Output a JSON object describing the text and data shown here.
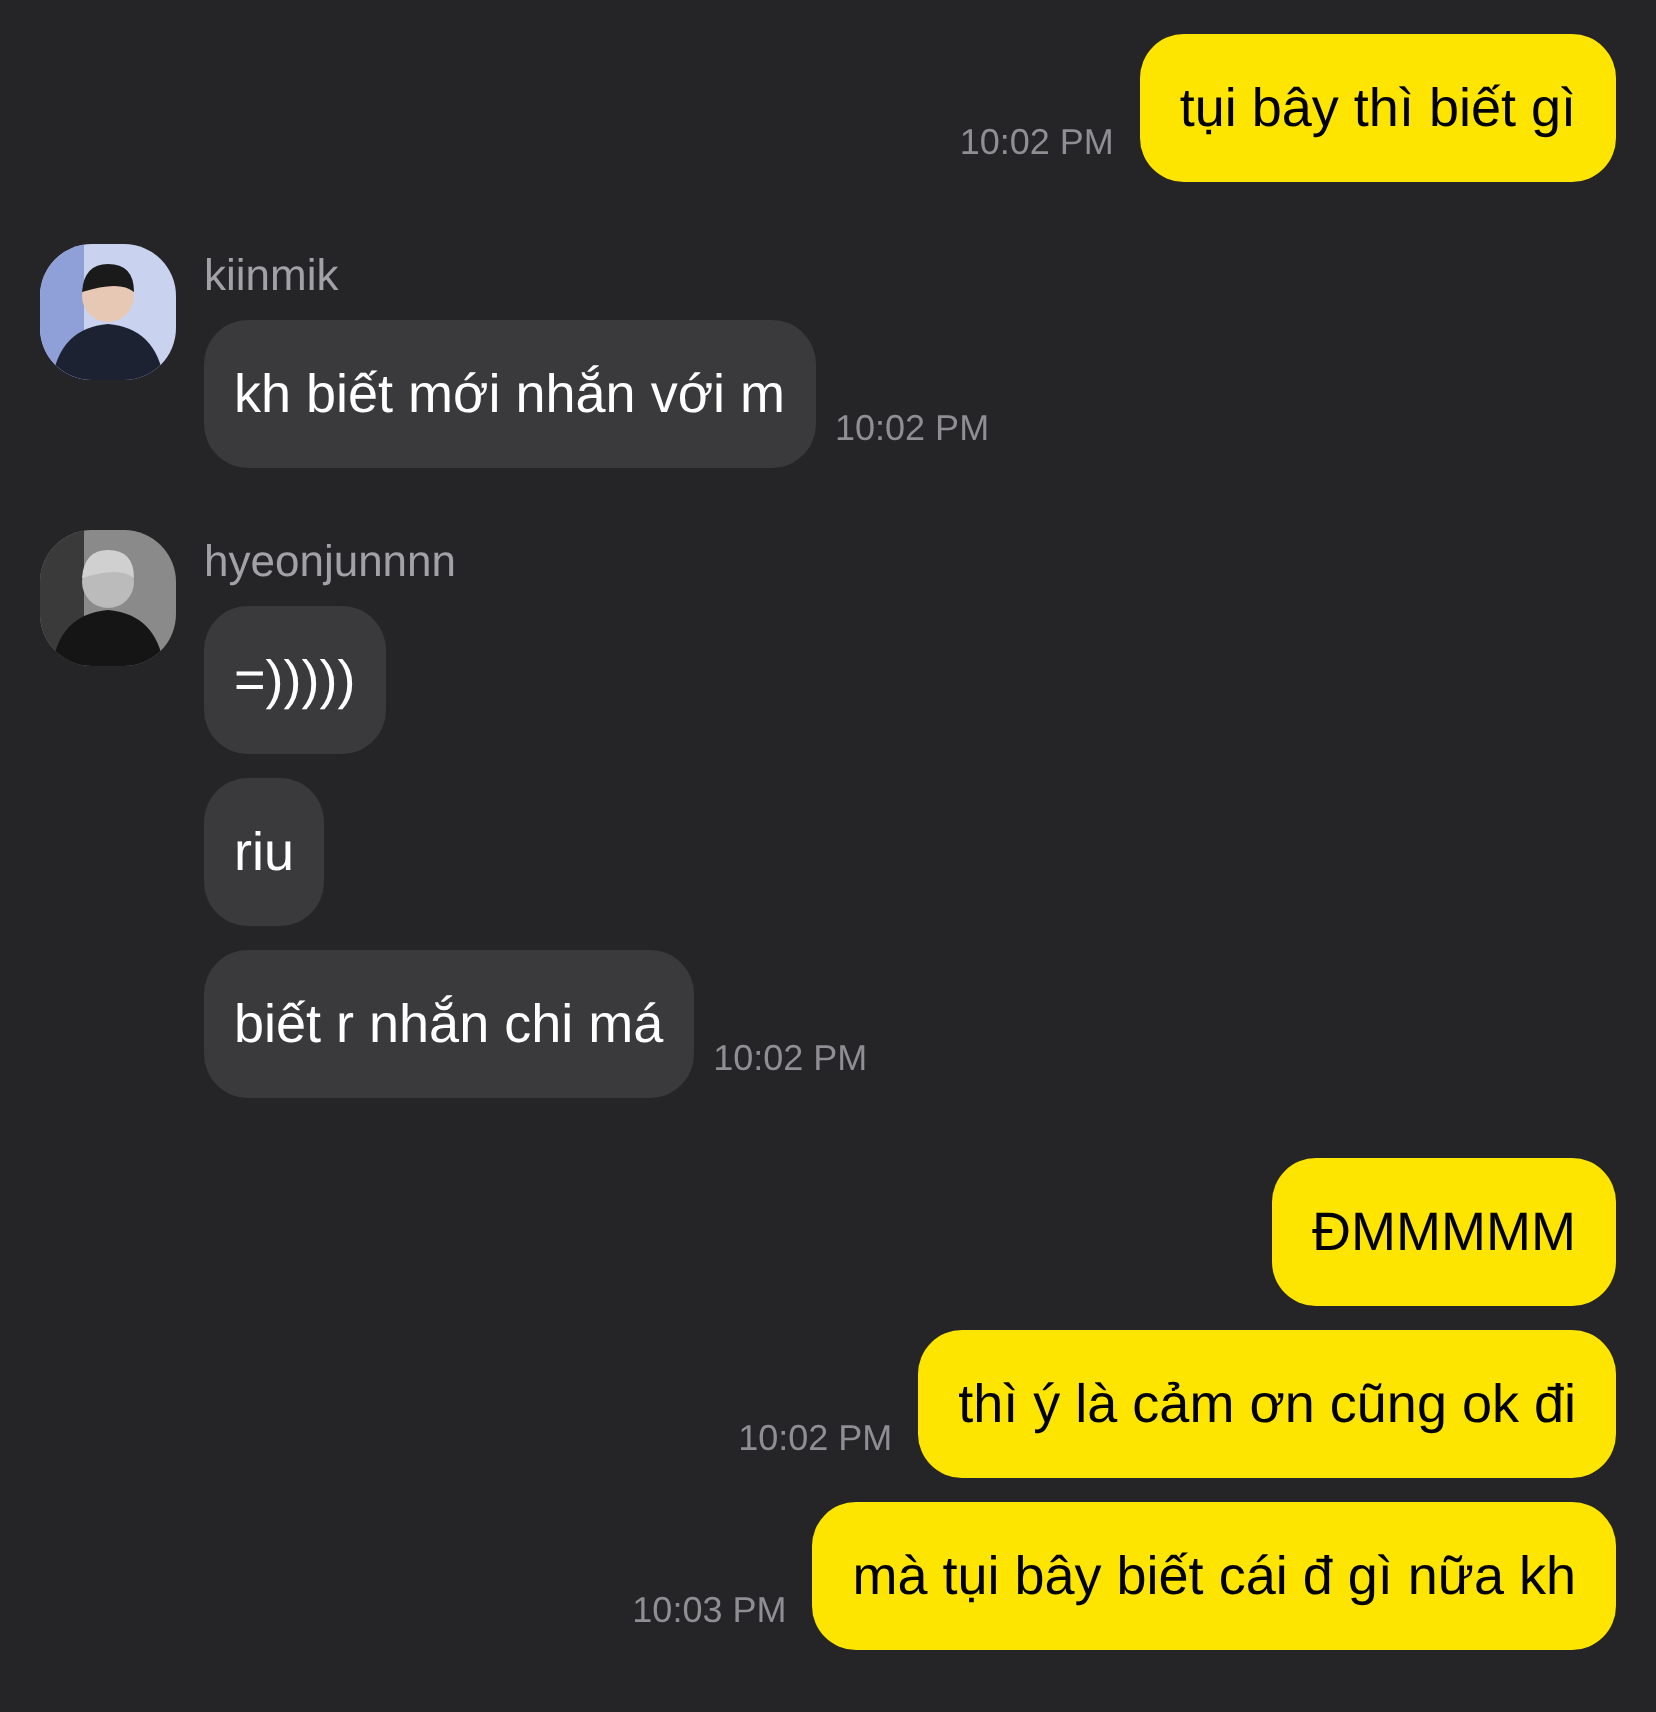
{
  "groups": [
    {
      "kind": "sent",
      "messages": [
        {
          "text": "tụi bây thì biết gì",
          "time": "10:02 PM"
        }
      ]
    },
    {
      "kind": "received",
      "sender": "kiinmik",
      "avatar": {
        "kind": "picture"
      },
      "messages": [
        {
          "text": "kh biết mới nhắn với m",
          "time": "10:02 PM"
        }
      ]
    },
    {
      "kind": "received",
      "sender": "hyeonjunnnn",
      "avatar": {
        "kind": "picture"
      },
      "messages": [
        {
          "text": "=)))))"
        },
        {
          "text": "riu"
        },
        {
          "text": "biết r nhắn chi má",
          "time": "10:02 PM"
        }
      ]
    },
    {
      "kind": "sent",
      "messages": [
        {
          "text": "ĐMMMMM"
        },
        {
          "text": "thì ý là cảm ơn cũng ok đi",
          "time": "10:02 PM"
        },
        {
          "text": "mà tụi bây biết cái đ gì nữa kh",
          "time": "10:03 PM"
        }
      ]
    }
  ]
}
